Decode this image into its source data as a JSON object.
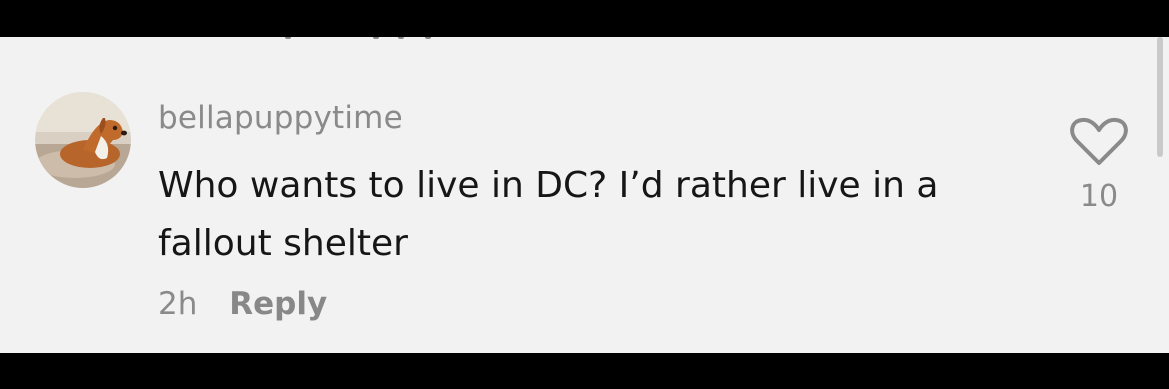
{
  "comment": {
    "username": "bellapuppytime",
    "text_line1": "Who wants to live in DC? I’d rather live in a",
    "text_line2": "fallout shelter",
    "time": "2h",
    "reply_label": "Reply",
    "like_count": "10",
    "like_icon": "heart-outline-icon",
    "avatar": "dog-avatar"
  },
  "colors": {
    "background": "#f2f2f2",
    "text": "#161616",
    "muted": "#8a8a8a",
    "letterbox": "#000000"
  }
}
